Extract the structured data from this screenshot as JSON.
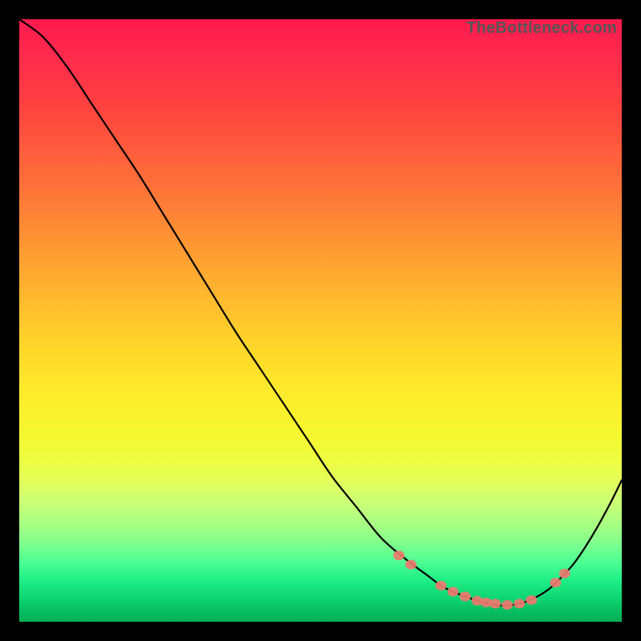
{
  "watermark": "TheBottleneck.com",
  "colors": {
    "line": "#000000",
    "dot": "#ee7a6f",
    "gradient_top": "#ff1a4d",
    "gradient_bottom": "#03ae55"
  },
  "chart_data": {
    "type": "line",
    "title": "",
    "xlabel": "",
    "ylabel": "",
    "xlim": [
      0,
      100
    ],
    "ylim": [
      0,
      100
    ],
    "x": [
      0,
      4,
      8,
      12,
      16,
      20,
      24,
      28,
      32,
      36,
      40,
      44,
      48,
      52,
      56,
      60,
      64,
      68,
      70,
      72,
      74,
      76,
      78,
      80,
      82,
      84,
      86,
      88,
      90,
      92,
      94,
      96,
      98,
      100
    ],
    "y": [
      100,
      97,
      92,
      86,
      80,
      74,
      67.5,
      61,
      54.5,
      48,
      42,
      36,
      30,
      24,
      19,
      14,
      10.5,
      7.5,
      6,
      5,
      4.2,
      3.5,
      3,
      2.7,
      2.8,
      3.3,
      4.2,
      5.5,
      7.4,
      9.6,
      12.5,
      15.8,
      19.5,
      23.5
    ],
    "dots": [
      {
        "x": 63,
        "y": 11
      },
      {
        "x": 65,
        "y": 9.5
      },
      {
        "x": 70,
        "y": 6
      },
      {
        "x": 72,
        "y": 5
      },
      {
        "x": 74,
        "y": 4.2
      },
      {
        "x": 76,
        "y": 3.5
      },
      {
        "x": 77.5,
        "y": 3.2
      },
      {
        "x": 79,
        "y": 3
      },
      {
        "x": 81,
        "y": 2.8
      },
      {
        "x": 83,
        "y": 3
      },
      {
        "x": 85,
        "y": 3.6
      },
      {
        "x": 89,
        "y": 6.5
      },
      {
        "x": 90.5,
        "y": 8
      }
    ],
    "annotations": []
  }
}
